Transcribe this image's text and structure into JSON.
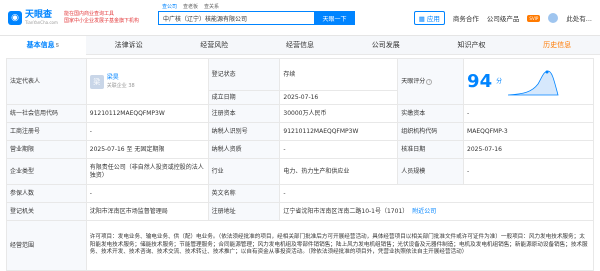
{
  "header": {
    "logo_name": "天眼查",
    "logo_sub": "TianYanCha.com",
    "slogan_line1": "能在国内商业查询工具",
    "slogan_line2": "国家中小企业发展子基金旗下机构",
    "search_tabs": [
      "查公司",
      "查老板",
      "查关系"
    ],
    "search_value": "中广核（辽宁）核能源有限公司",
    "search_button": "天眼一下",
    "app_label": "应用",
    "nav_items": [
      "商务合作",
      "公司级产品"
    ],
    "vip_label": "SVIP",
    "user_name": "此处有..."
  },
  "tabs": [
    {
      "label": "基本信息",
      "count": "5",
      "active": true
    },
    {
      "label": "法律诉讼",
      "count": ""
    },
    {
      "label": "经营风险",
      "count": ""
    },
    {
      "label": "经营信息",
      "count": ""
    },
    {
      "label": "公司发展",
      "count": ""
    },
    {
      "label": "知识产权",
      "count": ""
    },
    {
      "label": "历史信息",
      "count": ""
    }
  ],
  "info": {
    "legal_rep_label": "法定代表人",
    "legal_rep_avatar": "梁",
    "legal_rep_name": "梁昊",
    "legal_rep_meta": "关联企业 38",
    "reg_status_label": "登记状态",
    "reg_status": "存续",
    "founded_label": "成立日期",
    "founded": "2025-07-16",
    "score_label": "天眼评分",
    "score": "94",
    "score_unit": "分",
    "credit_code_label": "统一社会信用代码",
    "credit_code": "91210112MAEQQFMP3W",
    "reg_capital_label": "注册资本",
    "reg_capital": "30000万人民币",
    "paid_capital_label": "实缴资本",
    "paid_capital": "-",
    "biz_reg_no_label": "工商注册号",
    "biz_reg_no": "-",
    "taxpayer_id_label": "纳税人识别号",
    "taxpayer_id": "91210112MAEQQFMP3W",
    "org_code_label": "组织机构代码",
    "org_code": "MAEQQFMP-3",
    "term_label": "营业期限",
    "term": "2025-07-16 至 无固定期限",
    "taxpayer_quality_label": "纳税人资质",
    "taxpayer_quality": "-",
    "approve_date_label": "核准日期",
    "approve_date": "2025-07-16",
    "type_label": "企业类型",
    "type": "有限责任公司（非自然人投资或控股的法人独资）",
    "industry_label": "行业",
    "industry": "电力、热力生产和供应业",
    "staff_label": "人员规模",
    "staff": "-",
    "insured_label": "参保人数",
    "insured": "-",
    "english_name_label": "英文名称",
    "english_name": "-",
    "authority_label": "登记机关",
    "authority": "沈阳市浑南区市场监督管理局",
    "address_label": "注册地址",
    "address": "辽宁省沈阳市浑南区浑南二路10-1号（1701）",
    "nearby": "附近公司",
    "scope_label": "经营范围",
    "scope": "许可项目：发电业务、输电业务、供（配）电业务。（依法须经批准的项目，经相关部门批准后方可开展经营活动，具体经营项目以相关部门批准文件或许可证件为准）一般项目：风力发电技术服务；太阳能发电技术服务；储能技术服务；节能管理服务；合同能源管理；风力发电机组及零部件销销售；陆上风力发电机组销售；光伏设备及元器件制造；电机及发电机组销售；新能源原动设备销售；技术服务、技术开发、技术咨询、技术交流、技术转让、技术推广；以自有资金从事投资活动。（除依法须经批准的项目外，凭营业执照依法自主开展经营活动）"
  },
  "colors": {
    "accent": "#0084ff",
    "status_green": "#44b050",
    "history_orange": "#ff7a00"
  }
}
